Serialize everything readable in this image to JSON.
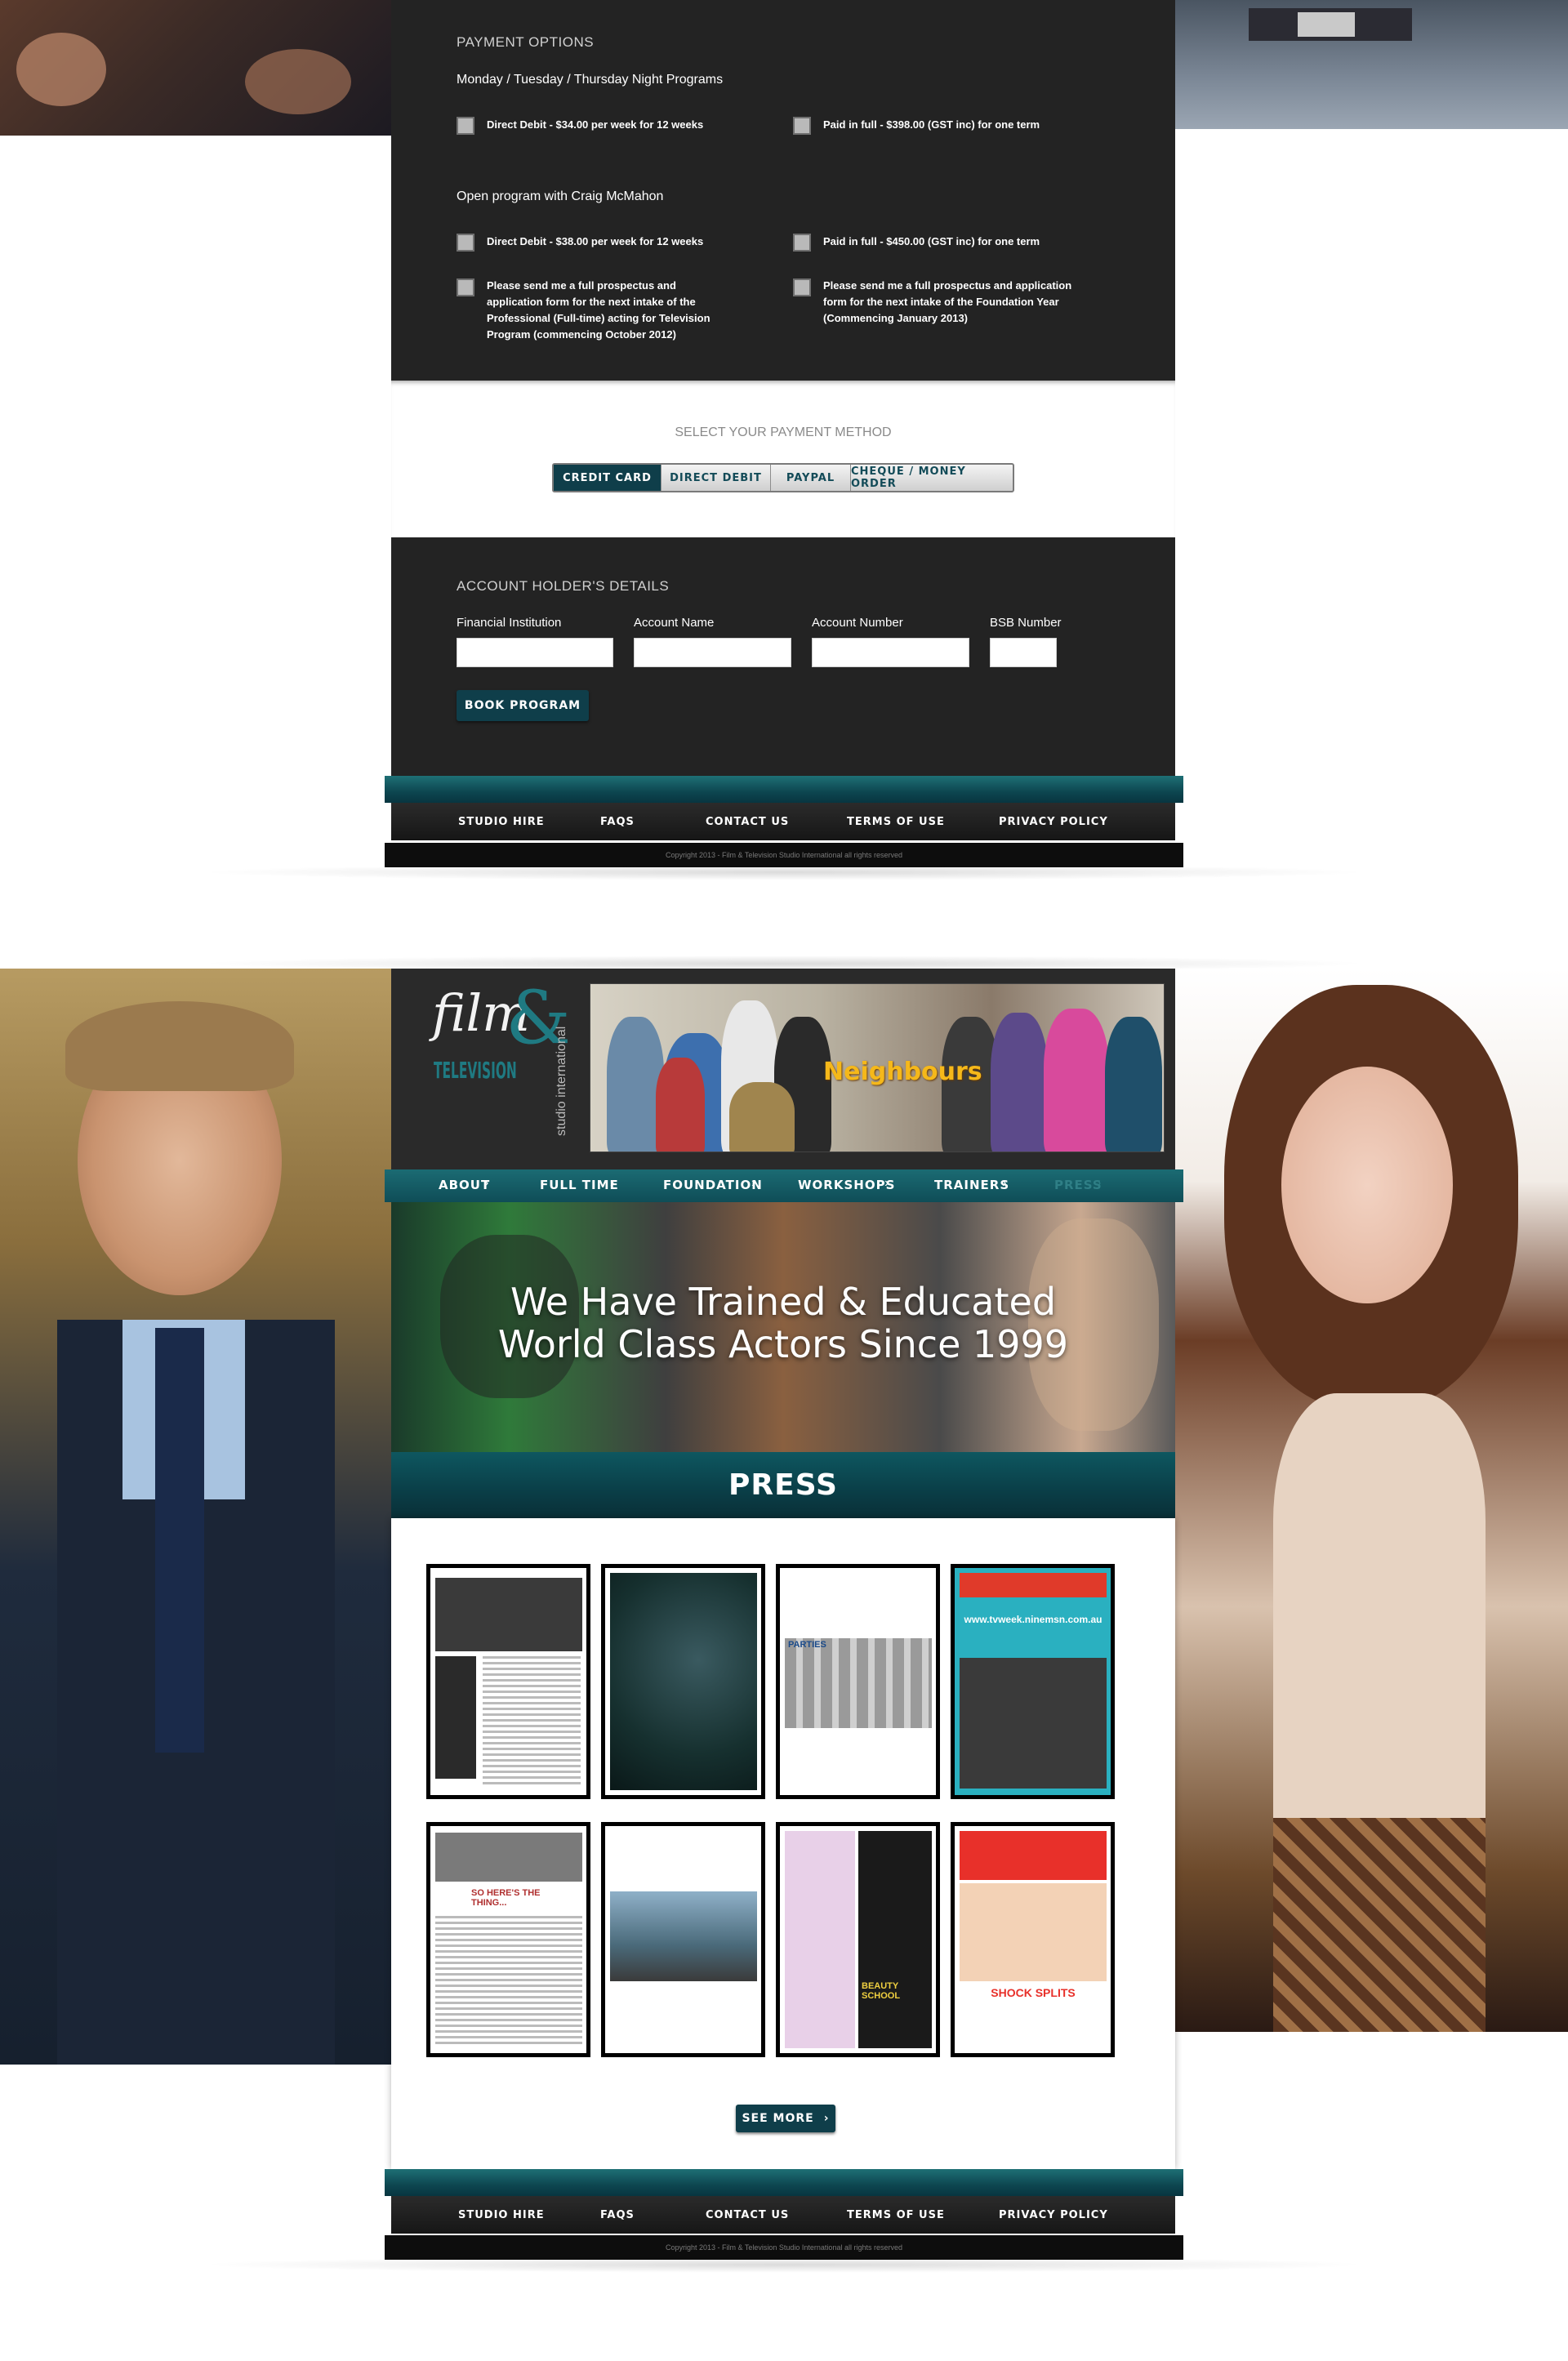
{
  "payment_options": {
    "heading": "PAYMENT OPTIONS",
    "group1_title": "Monday / Tuesday / Thursday Night Programs",
    "group1_opt_a": "Direct Debit - $34.00 per week for 12 weeks",
    "group1_opt_b": "Paid in full - $398.00 (GST inc) for one term",
    "group2_title": "Open program with Craig McMahon",
    "group2_opt_a": "Direct Debit - $38.00 per week for 12 weeks",
    "group2_opt_b": "Paid in full - $450.00 (GST inc) for one term",
    "prospectus_a": "Please send me a full prospectus and application form for the next intake of the Professional (Full-time) acting for Television Program (commencing October 2012)",
    "prospectus_b": "Please send me a full prospectus and application form for the next intake of the Foundation Year (Commencing January 2013)"
  },
  "payment_method": {
    "heading": "SELECT YOUR PAYMENT METHOD",
    "options": [
      "CREDIT CARD",
      "DIRECT DEBIT",
      "PAYPAL",
      "CHEQUE / MONEY ORDER"
    ],
    "selected": "CREDIT CARD"
  },
  "account": {
    "heading": "ACCOUNT HOLDER'S DETAILS",
    "labels": [
      "Financial Institution",
      "Account Name",
      "Account Number",
      "BSB Number"
    ],
    "book_button": "BOOK PROGRAM"
  },
  "footer": {
    "links": [
      "STUDIO HIRE",
      "FAQS",
      "CONTACT US",
      "TERMS OF USE",
      "PRIVACY POLICY"
    ],
    "copyright": "Copyright 2013 - Film & Television Studio International all rights reserved"
  },
  "header": {
    "logo_film": "film",
    "logo_amp": "&",
    "logo_tv": "TELEVISION",
    "logo_studio": "studio international",
    "banner_title": "Neighbours"
  },
  "nav": {
    "items": [
      "ABOUT",
      "FULL TIME",
      "FOUNDATION",
      "WORKSHOPS",
      "TRAINERS",
      "PRESS"
    ]
  },
  "hero": {
    "line1": "We Have Trained & Educated",
    "line2": "World Class Actors Since 1999"
  },
  "press": {
    "title": "PRESS",
    "thumbs": [
      {
        "caption": ""
      },
      {
        "caption": ""
      },
      {
        "caption": "PARTIES"
      },
      {
        "caption": "www.tvweek.ninemsn.com.au"
      },
      {
        "caption": "SO HERE'S THE THING..."
      },
      {
        "caption": ""
      },
      {
        "caption": "BEAUTY SCHOOL"
      },
      {
        "caption": "SHOCK SPLITS"
      }
    ],
    "see_more": "SEE MORE"
  },
  "colors": {
    "dark_panel": "#232323",
    "teal": "#0f3e4a",
    "teal_bar": "#0e5760"
  }
}
